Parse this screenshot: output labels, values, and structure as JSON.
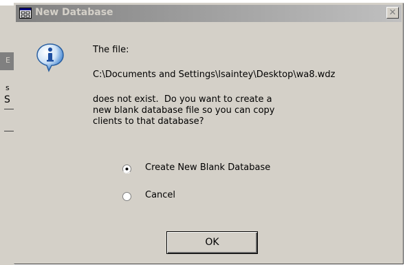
{
  "background_window": {
    "fragments": [
      "E",
      "s",
      "S"
    ]
  },
  "dialog": {
    "title": "New Database",
    "title_icon": "database-window-icon",
    "close_glyph": "✕",
    "message_icon": "info-icon",
    "message_line1": "The file:",
    "file_path": "C:\\Documents and Settings\\lsaintey\\Desktop\\wa8.wdz",
    "message_body": "does not exist.  Do you want to create a\nnew blank database file so you can copy\nclients to that database?",
    "options": [
      {
        "label": "Create New Blank Database",
        "selected": true
      },
      {
        "label": "Cancel",
        "selected": false
      }
    ],
    "ok_label": "OK"
  },
  "colors": {
    "dialog_face": "#d4d0c8",
    "title_gradient_start": "#808080",
    "title_gradient_end": "#c0c0c0",
    "info_icon_blue": "#3a7fd0"
  }
}
